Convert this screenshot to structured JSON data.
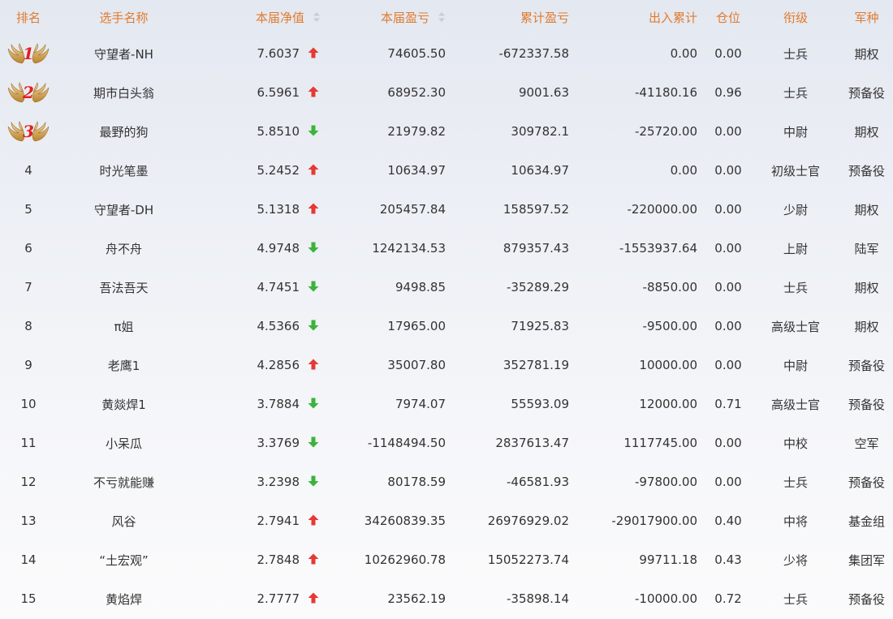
{
  "headers": {
    "rank": "排名",
    "name": "选手名称",
    "nav": "本届净值",
    "pnl": "本届盈亏",
    "cum": "累计盈亏",
    "flow": "出入累计",
    "position": "仓位",
    "rank_title": "衔级",
    "arm": "军种"
  },
  "colors": {
    "header_text": "#e07b2f",
    "up_arrow": "#e53935",
    "down_arrow": "#3bb33b",
    "medal_number": "#e02020"
  },
  "rows": [
    {
      "rank": "1",
      "medal": "wing-medal-icon",
      "name": "守望者-NH",
      "nav": "7.6037",
      "trend": "up",
      "pnl": "74605.50",
      "cum": "-672337.58",
      "flow": "0.00",
      "position": "0.00",
      "rank_title": "士兵",
      "arm": "期权"
    },
    {
      "rank": "2",
      "medal": "wing-medal-icon",
      "name": "期市白头翁",
      "nav": "6.5961",
      "trend": "up",
      "pnl": "68952.30",
      "cum": "9001.63",
      "flow": "-41180.16",
      "position": "0.96",
      "rank_title": "士兵",
      "arm": "预备役"
    },
    {
      "rank": "3",
      "medal": "wing-medal-icon",
      "name": "最野的狗",
      "nav": "5.8510",
      "trend": "down",
      "pnl": "21979.82",
      "cum": "309782.1",
      "flow": "-25720.00",
      "position": "0.00",
      "rank_title": "中尉",
      "arm": "期权"
    },
    {
      "rank": "4",
      "name": "时光笔墨",
      "nav": "5.2452",
      "trend": "up",
      "pnl": "10634.97",
      "cum": "10634.97",
      "flow": "0.00",
      "position": "0.00",
      "rank_title": "初级士官",
      "arm": "预备役"
    },
    {
      "rank": "5",
      "name": "守望者-DH",
      "nav": "5.1318",
      "trend": "up",
      "pnl": "205457.84",
      "cum": "158597.52",
      "flow": "-220000.00",
      "position": "0.00",
      "rank_title": "少尉",
      "arm": "期权"
    },
    {
      "rank": "6",
      "name": "舟不舟",
      "nav": "4.9748",
      "trend": "down",
      "pnl": "1242134.53",
      "cum": "879357.43",
      "flow": "-1553937.64",
      "position": "0.00",
      "rank_title": "上尉",
      "arm": "陆军"
    },
    {
      "rank": "7",
      "name": "吾法吾天",
      "nav": "4.7451",
      "trend": "down",
      "pnl": "9498.85",
      "cum": "-35289.29",
      "flow": "-8850.00",
      "position": "0.00",
      "rank_title": "士兵",
      "arm": "期权"
    },
    {
      "rank": "8",
      "name": "π姐",
      "nav": "4.5366",
      "trend": "down",
      "pnl": "17965.00",
      "cum": "71925.83",
      "flow": "-9500.00",
      "position": "0.00",
      "rank_title": "高级士官",
      "arm": "期权"
    },
    {
      "rank": "9",
      "name": "老鹰1",
      "nav": "4.2856",
      "trend": "up",
      "pnl": "35007.80",
      "cum": "352781.19",
      "flow": "10000.00",
      "position": "0.00",
      "rank_title": "中尉",
      "arm": "预备役"
    },
    {
      "rank": "10",
      "name": "黄燚焊1",
      "nav": "3.7884",
      "trend": "down",
      "pnl": "7974.07",
      "cum": "55593.09",
      "flow": "12000.00",
      "position": "0.71",
      "rank_title": "高级士官",
      "arm": "预备役"
    },
    {
      "rank": "11",
      "name": "小呆瓜",
      "nav": "3.3769",
      "trend": "down",
      "pnl": "-1148494.50",
      "cum": "2837613.47",
      "flow": "1117745.00",
      "position": "0.00",
      "rank_title": "中校",
      "arm": "空军"
    },
    {
      "rank": "12",
      "name": "不亏就能赚",
      "nav": "3.2398",
      "trend": "down",
      "pnl": "80178.59",
      "cum": "-46581.93",
      "flow": "-97800.00",
      "position": "0.00",
      "rank_title": "士兵",
      "arm": "预备役"
    },
    {
      "rank": "13",
      "name": "风谷",
      "nav": "2.7941",
      "trend": "up",
      "pnl": "34260839.35",
      "cum": "26976929.02",
      "flow": "-29017900.00",
      "position": "0.40",
      "rank_title": "中将",
      "arm": "基金组"
    },
    {
      "rank": "14",
      "name": "“土宏观”",
      "nav": "2.7848",
      "trend": "up",
      "pnl": "10262960.78",
      "cum": "15052273.74",
      "flow": "99711.18",
      "position": "0.43",
      "rank_title": "少将",
      "arm": "集团军"
    },
    {
      "rank": "15",
      "name": "黄焰焊",
      "nav": "2.7777",
      "trend": "up",
      "pnl": "23562.19",
      "cum": "-35898.14",
      "flow": "-10000.00",
      "position": "0.72",
      "rank_title": "士兵",
      "arm": "预备役"
    }
  ]
}
